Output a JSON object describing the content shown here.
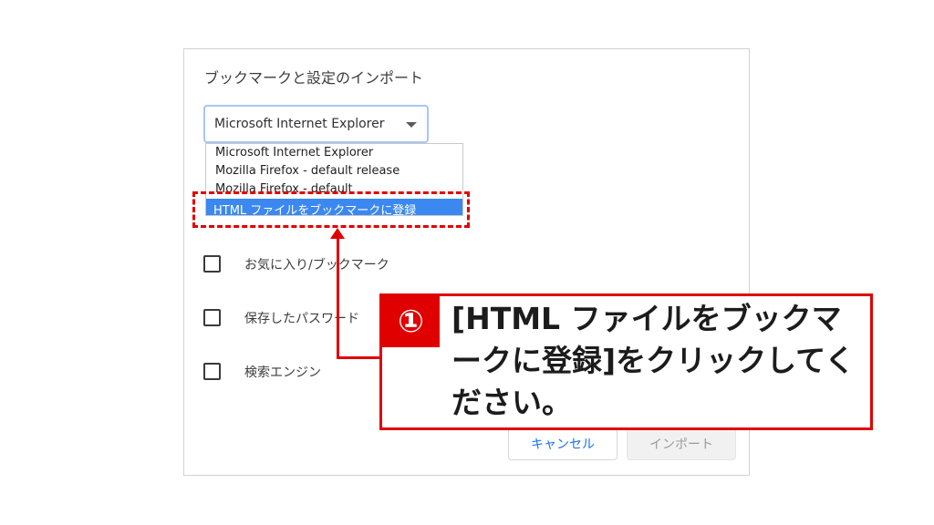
{
  "dialog": {
    "title": "ブックマークと設定のインポート",
    "select": {
      "value": "Microsoft Internet Explorer",
      "options": [
        "Microsoft Internet Explorer",
        "Mozilla Firefox - default release",
        "Mozilla Firefox - default",
        "HTML ファイルをブックマークに登録"
      ],
      "selected_option": "HTML ファイルをブックマークに登録"
    },
    "checkboxes": [
      {
        "label": "お気に入り/ブックマーク",
        "checked": false
      },
      {
        "label": "保存したパスワード",
        "checked": false
      },
      {
        "label": "検索エンジン",
        "checked": false
      }
    ],
    "buttons": {
      "cancel": "キャンセル",
      "import": "インポート"
    }
  },
  "annotation": {
    "step": "①",
    "text": "[HTML ファイルをブックマークに登録]をクリックしてください。",
    "color": "#e00000"
  },
  "colors": {
    "accent": "#1a73e8",
    "selected_bg": "#3b88f0"
  }
}
